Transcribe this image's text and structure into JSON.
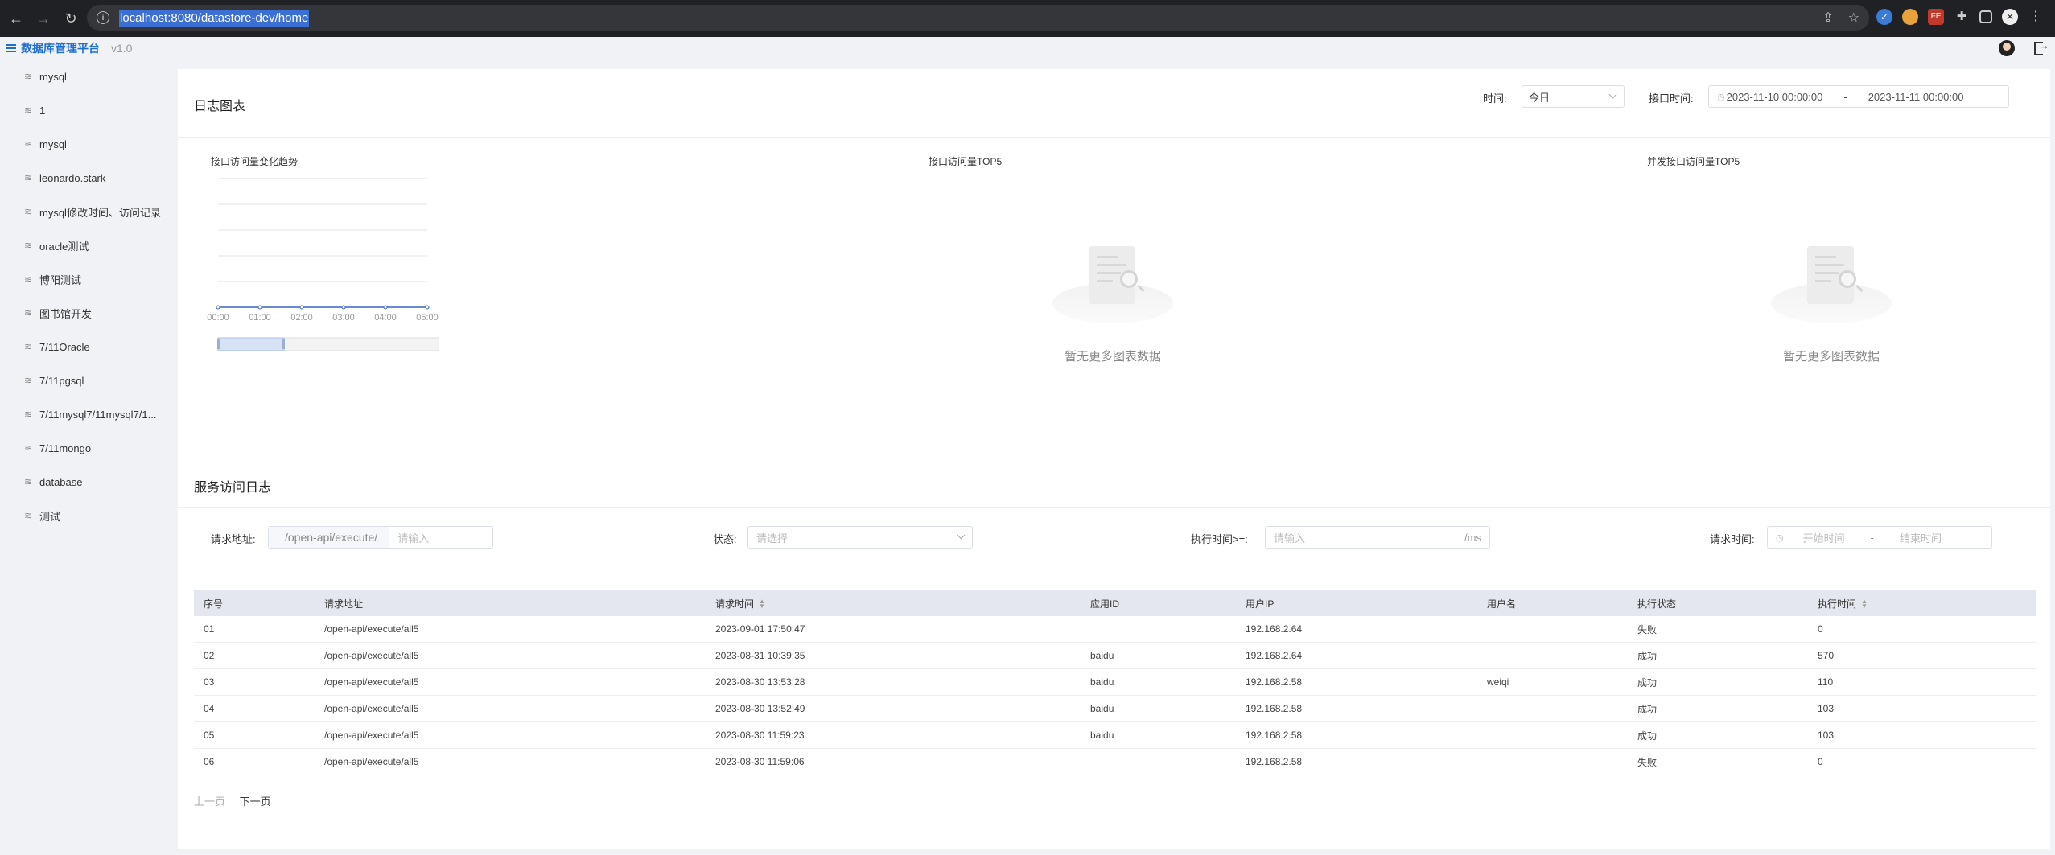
{
  "browser": {
    "url": "localhost:8080/datastore-dev/home"
  },
  "app": {
    "title": "数据库管理平台",
    "version": "v1.0"
  },
  "sidebar": {
    "items": [
      {
        "label": "mysql"
      },
      {
        "label": "1"
      },
      {
        "label": "mysql"
      },
      {
        "label": "leonardo.stark"
      },
      {
        "label": "mysql修改时间、访问记录"
      },
      {
        "label": "oracle测试"
      },
      {
        "label": "博阳测试"
      },
      {
        "label": "图书馆开发"
      },
      {
        "label": "7/11Oracle"
      },
      {
        "label": "7/11pgsql"
      },
      {
        "label": "7/11mysql7/11mysql7/1..."
      },
      {
        "label": "7/11mongo"
      },
      {
        "label": "database"
      },
      {
        "label": "测试"
      }
    ]
  },
  "log_chart": {
    "title": "日志图表",
    "time_label": "时间:",
    "time_value": "今日",
    "api_time_label": "接口时间:",
    "range_start": "2023-11-10 00:00:00",
    "range_sep": "-",
    "range_end": "2023-11-11 00:00:00",
    "chart1_title": "接口访问量变化趋势",
    "chart2_title": "接口访问量TOP5",
    "chart3_title": "并发接口访问量TOP5",
    "empty_text": "暂无更多图表数据"
  },
  "chart_data": {
    "type": "line",
    "title": "接口访问量变化趋势",
    "categories": [
      "00:00",
      "01:00",
      "02:00",
      "03:00",
      "04:00",
      "05:00"
    ],
    "values": [
      0,
      0,
      0,
      0,
      0,
      0
    ],
    "color": "#3a63c8",
    "grid": true,
    "ylim": [
      0,
      5
    ]
  },
  "service_log": {
    "title": "服务访问日志",
    "url_label": "请求地址:",
    "url_prefix": "/open-api/execute/",
    "url_placeholder": "请输入",
    "status_label": "状态:",
    "status_placeholder": "请选择",
    "exec_label": "执行时间>=:",
    "exec_placeholder": "请输入",
    "exec_unit": "/ms",
    "req_time_label": "请求时间:",
    "start_placeholder": "开始时间",
    "time_sep": "-",
    "end_placeholder": "结束时间"
  },
  "table": {
    "headers": [
      "序号",
      "请求地址",
      "请求时间",
      "应用ID",
      "用户IP",
      "用户名",
      "执行状态",
      "执行时间"
    ],
    "rows": [
      [
        "01",
        "/open-api/execute/all5",
        "2023-09-01 17:50:47",
        "",
        "192.168.2.64",
        "",
        "失败",
        "0"
      ],
      [
        "02",
        "/open-api/execute/all5",
        "2023-08-31 10:39:35",
        "baidu",
        "192.168.2.64",
        "",
        "成功",
        "570"
      ],
      [
        "03",
        "/open-api/execute/all5",
        "2023-08-30 13:53:28",
        "baidu",
        "192.168.2.58",
        "weiqi",
        "成功",
        "110"
      ],
      [
        "04",
        "/open-api/execute/all5",
        "2023-08-30 13:52:49",
        "baidu",
        "192.168.2.58",
        "",
        "成功",
        "103"
      ],
      [
        "05",
        "/open-api/execute/all5",
        "2023-08-30 11:59:23",
        "baidu",
        "192.168.2.58",
        "",
        "成功",
        "103"
      ],
      [
        "06",
        "/open-api/execute/all5",
        "2023-08-30 11:59:06",
        "",
        "192.168.2.58",
        "",
        "失败",
        "0"
      ]
    ]
  },
  "pager": {
    "prev": "上一页",
    "next": "下一页"
  }
}
